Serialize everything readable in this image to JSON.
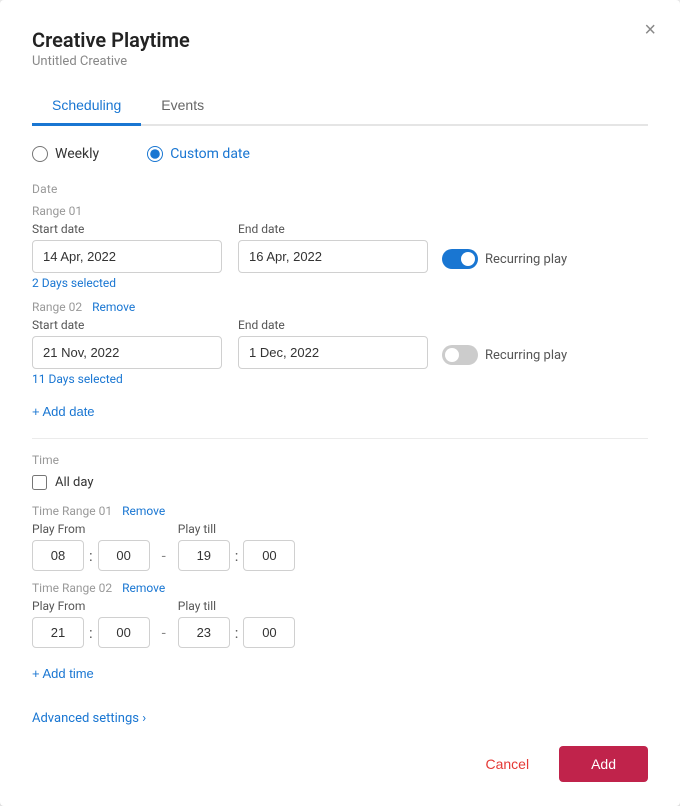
{
  "modal": {
    "title": "Creative Playtime",
    "subtitle": "Untitled Creative",
    "close_icon": "×"
  },
  "tabs": [
    {
      "id": "scheduling",
      "label": "Scheduling",
      "active": true
    },
    {
      "id": "events",
      "label": "Events",
      "active": false
    }
  ],
  "radio_options": [
    {
      "id": "weekly",
      "label": "Weekly",
      "selected": false
    },
    {
      "id": "custom_date",
      "label": "Custom date",
      "selected": true
    }
  ],
  "date_section": {
    "label": "Date",
    "ranges": [
      {
        "id": "range_01",
        "header": "Range 01",
        "show_remove": false,
        "start_label": "Start date",
        "start_value": "14 Apr, 2022",
        "end_label": "End date",
        "end_value": "16 Apr, 2022",
        "recurring_label": "Recurring play",
        "recurring_enabled": true,
        "days_selected": "2 Days selected"
      },
      {
        "id": "range_02",
        "header": "Range 02",
        "show_remove": true,
        "remove_label": "Remove",
        "start_label": "Start date",
        "start_value": "21 Nov, 2022",
        "end_label": "End date",
        "end_value": "1 Dec, 2022",
        "recurring_label": "Recurring play",
        "recurring_enabled": false,
        "days_selected": "11 Days selected"
      }
    ],
    "add_label": "+ Add date"
  },
  "time_section": {
    "label": "Time",
    "allday_label": "All day",
    "ranges": [
      {
        "id": "time_range_01",
        "header": "Time Range 01",
        "show_remove": true,
        "remove_label": "Remove",
        "play_from_label": "Play From",
        "play_from_h": "08",
        "play_from_m": "00",
        "play_till_label": "Play till",
        "play_till_h": "19",
        "play_till_m": "00"
      },
      {
        "id": "time_range_02",
        "header": "Time Range 02",
        "show_remove": true,
        "remove_label": "Remove",
        "play_from_label": "Play From",
        "play_from_h": "21",
        "play_from_m": "00",
        "play_till_label": "Play till",
        "play_till_h": "23",
        "play_till_m": "00"
      }
    ],
    "add_label": "+ Add time"
  },
  "advanced_settings_label": "Advanced settings ›",
  "footer": {
    "cancel_label": "Cancel",
    "add_label": "Add"
  }
}
